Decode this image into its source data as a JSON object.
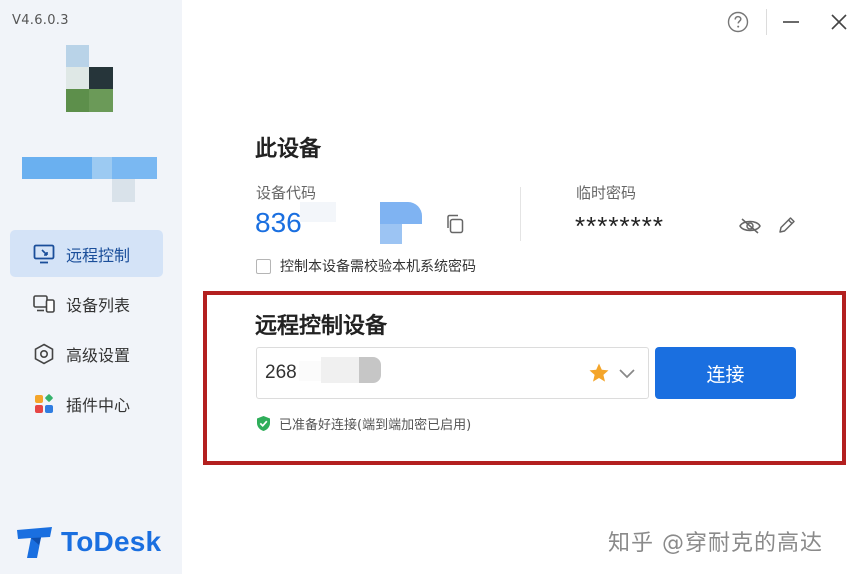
{
  "app": {
    "version": "V4.6.0.3",
    "brand_name": "ToDesk",
    "accent_color": "#1a6fe0",
    "highlight_color": "#b3201f"
  },
  "sidebar": {
    "items": [
      {
        "label": "远程控制",
        "icon": "monitor-remote-icon",
        "active": true
      },
      {
        "label": "设备列表",
        "icon": "device-list-icon",
        "active": false
      },
      {
        "label": "高级设置",
        "icon": "hexagon-settings-icon",
        "active": false
      },
      {
        "label": "插件中心",
        "icon": "plugins-icon",
        "active": false
      }
    ]
  },
  "window_controls": {
    "help": "help-icon",
    "minimize": "minimize-icon",
    "close": "close-icon"
  },
  "this_device": {
    "title": "此设备",
    "device_code_label": "设备代码",
    "device_code_visible": "836",
    "temp_password_label": "临时密码",
    "temp_password": "********",
    "verify_checkbox_label": "控制本设备需校验本机系统密码",
    "verify_checked": false
  },
  "remote": {
    "title": "远程控制设备",
    "input_value": "268",
    "connect_label": "连接",
    "status_text": "已准备好连接(端到端加密已启用)"
  },
  "watermark": "知乎 @穿耐克的高达"
}
